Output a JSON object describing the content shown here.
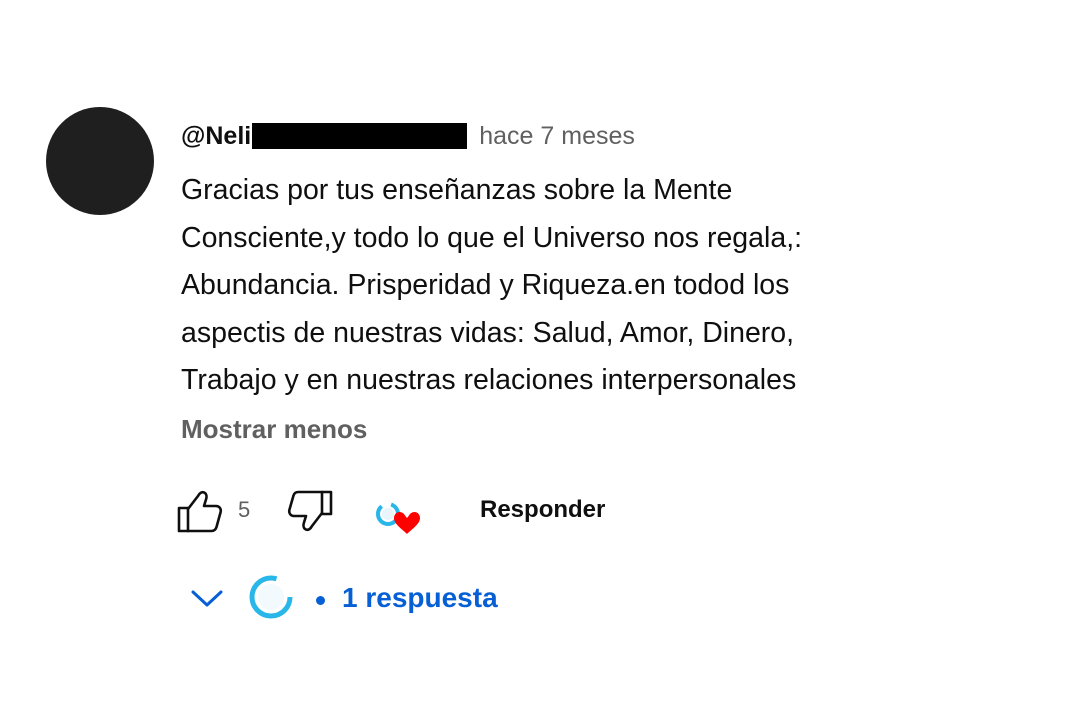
{
  "comment": {
    "author": "@Neli",
    "timestamp": "hace 7 meses",
    "text_lines": [
      "Gracias por tus enseñanzas sobre la Mente",
      "Consciente,y todo lo que el Universo nos regala,:",
      "Abundancia. Prisperidad y Riqueza.en todod los",
      "aspectis de nuestras vidas: Salud, Amor, Dinero,",
      "Trabajo y en nuestras relaciones interpersonales"
    ],
    "show_less_label": "Mostrar menos"
  },
  "actions": {
    "like_icon": "thumb-up-icon",
    "like_count": "5",
    "dislike_icon": "thumb-down-icon",
    "creator_heart_icon": "creator-heart-icon",
    "reply_label": "Responder"
  },
  "replies": {
    "expand_icon": "chevron-down-icon",
    "dot": "•",
    "label": "1 respuesta"
  },
  "colors": {
    "link_blue": "#065fd4",
    "heart_red": "#ff0000",
    "creator_avatar_cyan": "#29b6e8",
    "secondary_text": "#606060"
  }
}
